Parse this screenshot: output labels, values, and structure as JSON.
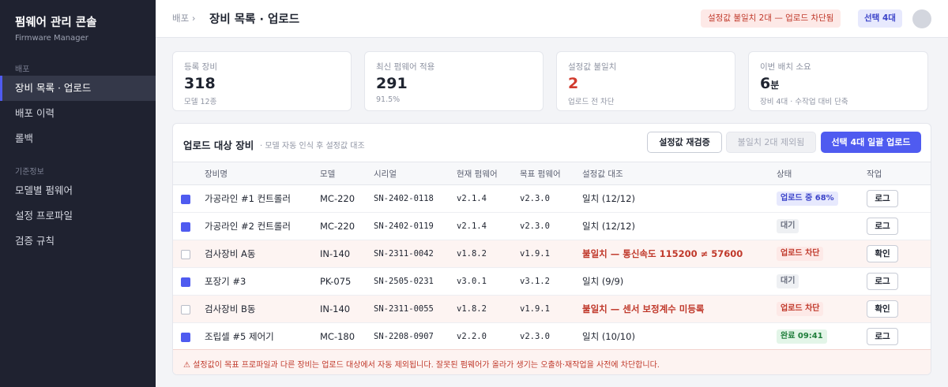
{
  "sidebar": {
    "title": "펌웨어 관리 콘솔",
    "subtitle": "Firmware Manager",
    "section1": "배포",
    "items1": [
      "장비 목록 · 업로드",
      "배포 이력",
      "롤백"
    ],
    "section2": "기준정보",
    "items2": [
      "모델별 펌웨어",
      "설정 프로파일",
      "검증 규칙"
    ]
  },
  "header": {
    "breadcrumb": "배포 ›",
    "title": "장비 목록 · 업로드",
    "warning_badge": "설정값 불일치 2대 — 업로드 차단됨",
    "selection_badge": "선택 4대"
  },
  "cards": [
    {
      "label": "등록 장비",
      "value": "318",
      "unit": "",
      "sub": "모델 12종"
    },
    {
      "label": "최신 펌웨어 적용",
      "value": "291",
      "unit": "",
      "sub": "91.5%"
    },
    {
      "label": "설정값 불일치",
      "value": "2",
      "unit": "",
      "sub": "업로드 전 차단"
    },
    {
      "label": "이번 배치 소요",
      "value": "6",
      "unit": "분",
      "sub": "장비 4대 · 수작업 대비 단축"
    }
  ],
  "panel": {
    "title": "업로드 대상 장비",
    "subtitle": "· 모델 자동 인식 후 설정값 대조",
    "btn_revalidate": "설정값 재검증",
    "btn_excluded": "불일치 2대 제외됨",
    "btn_upload": "선택 4대 일괄 업로드"
  },
  "columns": [
    "장비명",
    "모델",
    "시리얼",
    "현재 펌웨어",
    "목표 펌웨어",
    "설정값 대조",
    "상태",
    "작업"
  ],
  "rows": [
    {
      "checked": true,
      "name": "가공라인 #1 컨트롤러",
      "model": "MC-220",
      "serial": "SN-2402-0118",
      "current": "v2.1.4",
      "target": "v2.3.0",
      "compare": "일치 (12/12)",
      "mismatch": false,
      "status": "업로드 중 68%",
      "status_type": "progress",
      "action": "로그"
    },
    {
      "checked": true,
      "name": "가공라인 #2 컨트롤러",
      "model": "MC-220",
      "serial": "SN-2402-0119",
      "current": "v2.1.4",
      "target": "v2.3.0",
      "compare": "일치 (12/12)",
      "mismatch": false,
      "status": "대기",
      "status_type": "wait",
      "action": "로그"
    },
    {
      "checked": false,
      "name": "검사장비 A동",
      "model": "IN-140",
      "serial": "SN-2311-0042",
      "current": "v1.8.2",
      "target": "v1.9.1",
      "compare": "불일치 — 통신속도 115200 ≠ 57600",
      "mismatch": true,
      "status": "업로드 차단",
      "status_type": "block",
      "action": "확인"
    },
    {
      "checked": true,
      "name": "포장기 #3",
      "model": "PK-075",
      "serial": "SN-2505-0231",
      "current": "v3.0.1",
      "target": "v3.1.2",
      "compare": "일치 (9/9)",
      "mismatch": false,
      "status": "대기",
      "status_type": "wait",
      "action": "로그"
    },
    {
      "checked": false,
      "name": "검사장비 B동",
      "model": "IN-140",
      "serial": "SN-2311-0055",
      "current": "v1.8.2",
      "target": "v1.9.1",
      "compare": "불일치 — 센서 보정계수 미등록",
      "mismatch": true,
      "status": "업로드 차단",
      "status_type": "block",
      "action": "확인"
    },
    {
      "checked": true,
      "name": "조립셀 #5 제어기",
      "model": "MC-180",
      "serial": "SN-2208-0907",
      "current": "v2.2.0",
      "target": "v2.3.0",
      "compare": "일치 (10/10)",
      "mismatch": false,
      "status": "완료 09:41",
      "status_type": "done",
      "action": "로그"
    }
  ],
  "notice": "⚠ 설정값이 목표 프로파일과 다른 장비는 업로드 대상에서 자동 제외됩니다. 잘못된 펌웨어가 올라가 생기는 오출하·재작업을 사전에 차단합니다."
}
